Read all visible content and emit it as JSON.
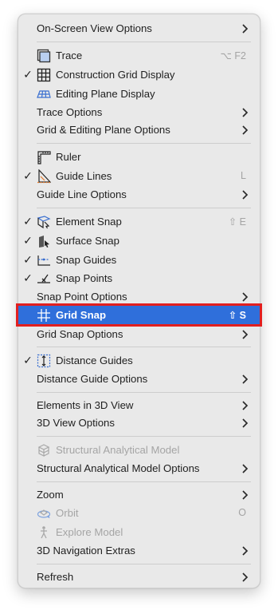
{
  "menu": {
    "on_screen_view_options": "On-Screen View Options",
    "trace": "Trace",
    "trace_shortcut": "⌥ F2",
    "construction_grid_display": "Construction Grid Display",
    "editing_plane_display": "Editing Plane Display",
    "trace_options": "Trace Options",
    "grid_editing_plane_options": "Grid & Editing Plane Options",
    "ruler": "Ruler",
    "guide_lines": "Guide Lines",
    "guide_lines_shortcut": "L",
    "guide_line_options": "Guide Line Options",
    "element_snap": "Element Snap",
    "element_snap_shortcut": "⇧ E",
    "surface_snap": "Surface Snap",
    "snap_guides": "Snap Guides",
    "snap_points": "Snap Points",
    "snap_point_options": "Snap Point Options",
    "grid_snap": "Grid Snap",
    "grid_snap_shortcut": "⇧ S",
    "grid_snap_options": "Grid Snap Options",
    "distance_guides": "Distance Guides",
    "distance_guide_options": "Distance Guide Options",
    "elements_in_3d_view": "Elements in 3D View",
    "view_3d_options": "3D View Options",
    "structural_analytical_model": "Structural Analytical Model",
    "structural_analytical_model_options": "Structural Analytical Model Options",
    "zoom": "Zoom",
    "orbit": "Orbit",
    "orbit_shortcut": "O",
    "explore_model": "Explore Model",
    "navigation_extras_3d": "3D Navigation Extras",
    "refresh": "Refresh",
    "checkmark": "✓"
  },
  "colors": {
    "highlight": "#2f6fdb",
    "highlight_outline": "#e21f1f",
    "menu_bg": "#e9e9e9",
    "disabled_text": "#a5a5a5"
  },
  "icons": {
    "trace": "trace-icon",
    "construction_grid": "construction-grid-icon",
    "editing_plane": "editing-plane-icon",
    "ruler": "ruler-icon",
    "guide_lines": "guide-lines-icon",
    "element_snap": "element-snap-icon",
    "surface_snap": "surface-snap-icon",
    "snap_guides": "snap-guides-icon",
    "snap_points": "snap-points-icon",
    "grid_snap": "grid-snap-icon",
    "distance_guides": "distance-guides-icon",
    "structural_model": "structural-model-icon",
    "orbit": "orbit-icon",
    "explore_model": "explore-model-icon"
  }
}
